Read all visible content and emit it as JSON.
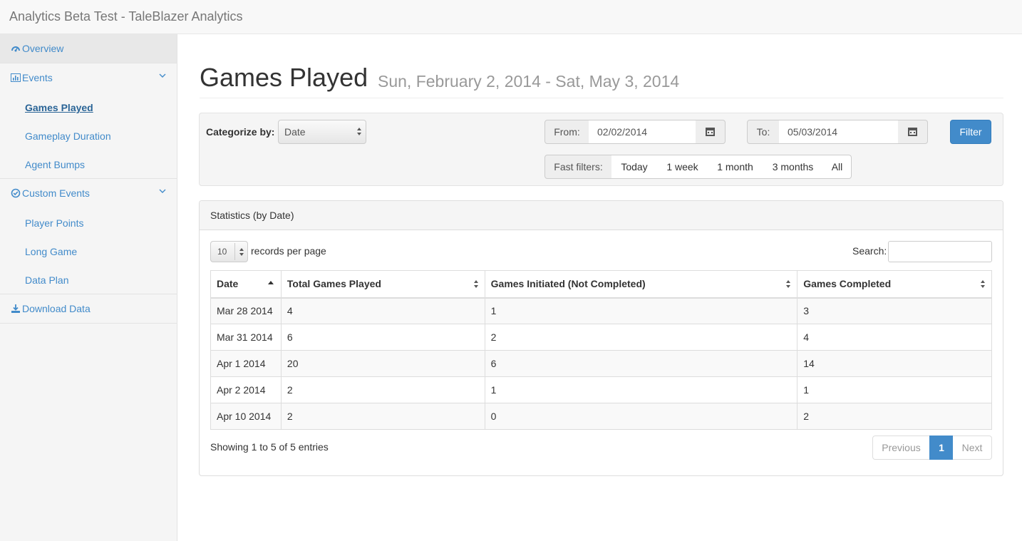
{
  "app": {
    "title": "Analytics Beta Test - TaleBlazer Analytics"
  },
  "sidebar": {
    "overview": {
      "label": "Overview",
      "icon": "dashboard-icon"
    },
    "events": {
      "label": "Events",
      "icon": "bar-chart-icon",
      "items": [
        {
          "label": "Games Played",
          "current": true
        },
        {
          "label": "Gameplay Duration"
        },
        {
          "label": "Agent Bumps"
        }
      ]
    },
    "custom_events": {
      "label": "Custom Events",
      "icon": "check-circle-icon",
      "items": [
        {
          "label": "Player Points"
        },
        {
          "label": "Long Game"
        },
        {
          "label": "Data Plan"
        }
      ]
    },
    "download": {
      "label": "Download Data",
      "icon": "download-icon"
    }
  },
  "page": {
    "title": "Games Played",
    "subtitle": "Sun, February 2, 2014 - Sat, May 3, 2014"
  },
  "filters": {
    "categorize_label": "Categorize by:",
    "categorize_value": "Date",
    "from_label": "From:",
    "from_value": "02/02/2014",
    "to_label": "To:",
    "to_value": "05/03/2014",
    "filter_button": "Filter",
    "fast_label": "Fast filters:",
    "fast": [
      "Today",
      "1 week",
      "1 month",
      "3 months",
      "All"
    ]
  },
  "stats": {
    "heading": "Statistics (by Date)",
    "page_length": "10",
    "page_length_label": "records per page",
    "search_label": "Search:",
    "search_value": "",
    "columns": [
      "Date",
      "Total Games Played",
      "Games Initiated (Not Completed)",
      "Games Completed"
    ],
    "rows": [
      [
        "Mar 28 2014",
        "4",
        "1",
        "3"
      ],
      [
        "Mar 31 2014",
        "6",
        "2",
        "4"
      ],
      [
        "Apr 1 2014",
        "20",
        "6",
        "14"
      ],
      [
        "Apr 2 2014",
        "2",
        "1",
        "1"
      ],
      [
        "Apr 10 2014",
        "2",
        "0",
        "2"
      ]
    ],
    "info": "Showing 1 to 5 of 5 entries",
    "pagination": {
      "prev": "Previous",
      "current": "1",
      "next": "Next"
    }
  },
  "colors": {
    "link": "#428bca",
    "primary": "#428bca",
    "muted": "#999999"
  }
}
